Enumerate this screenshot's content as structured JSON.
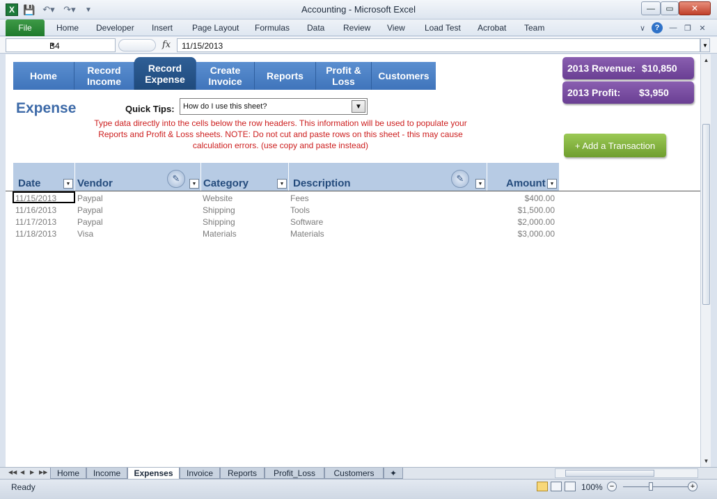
{
  "window": {
    "title": "Accounting  -  Microsoft Excel",
    "qat_logo": "X",
    "qat_save_icon": "save-icon",
    "buttons": {
      "minimize": "—",
      "maximize": "▭",
      "close": "✕"
    }
  },
  "ribbon": {
    "file_label": "File",
    "tabs": [
      "Home",
      "Developer",
      "Insert",
      "Page Layout",
      "Formulas",
      "Data",
      "Review",
      "View",
      "Load Test",
      "Acrobat",
      "Team"
    ]
  },
  "formula_bar": {
    "name_box": "B4",
    "fx_label": "fx",
    "value": "11/15/2013"
  },
  "nav": {
    "items": [
      {
        "label": "Home",
        "active": false
      },
      {
        "label": "Record\nIncome",
        "active": false
      },
      {
        "label": "Record\nExpense",
        "active": true
      },
      {
        "label": "Create\nInvoice",
        "active": false
      },
      {
        "label": "Reports",
        "active": false
      },
      {
        "label": "Profit &\nLoss",
        "active": false
      },
      {
        "label": "Customers",
        "active": false
      }
    ]
  },
  "page": {
    "title": "Expense",
    "quick_tips_label": "Quick Tips:",
    "quick_tips_value": "How do I use this sheet?",
    "tip_text": "Type data directly into the cells below the row headers.  This information will be used to populate your Reports and Profit & Loss sheets.  NOTE: Do not cut and paste rows on this sheet - this may cause calculation errors. (use copy and paste instead)"
  },
  "kpis": {
    "revenue_label": "2013 Revenue:",
    "revenue_value": "$10,850",
    "profit_label": "2013 Profit:",
    "profit_value": "$3,950"
  },
  "add_button": "+ Add a Transaction",
  "table": {
    "columns": [
      "Date",
      "Vendor",
      "Category",
      "Description",
      "Amount"
    ],
    "rows": [
      [
        "11/15/2013",
        "Paypal",
        "Website",
        "Fees",
        "$400.00"
      ],
      [
        "11/16/2013",
        "Paypal",
        "Shipping",
        "Tools",
        "$1,500.00"
      ],
      [
        "11/17/2013",
        "Paypal",
        "Shipping",
        "Software",
        "$2,000.00"
      ],
      [
        "11/18/2013",
        "Visa",
        "Materials",
        "Materials",
        "$3,000.00"
      ]
    ]
  },
  "sheet_tabs": [
    {
      "label": "Home",
      "active": false
    },
    {
      "label": "Income",
      "active": false
    },
    {
      "label": "Expenses",
      "active": true
    },
    {
      "label": "Invoice",
      "active": false
    },
    {
      "label": "Reports",
      "active": false
    },
    {
      "label": "Profit_Loss",
      "active": false
    },
    {
      "label": "Customers",
      "active": false
    }
  ],
  "status": {
    "ready": "Ready",
    "zoom": "100%"
  },
  "colors": {
    "nav": "#4a7fc4",
    "nav_active": "#2a5589",
    "kpi": "#7b4fa3",
    "add_button": "#86b843",
    "tip_text": "#cc1d1d",
    "table_header": "#b7cbe4"
  }
}
